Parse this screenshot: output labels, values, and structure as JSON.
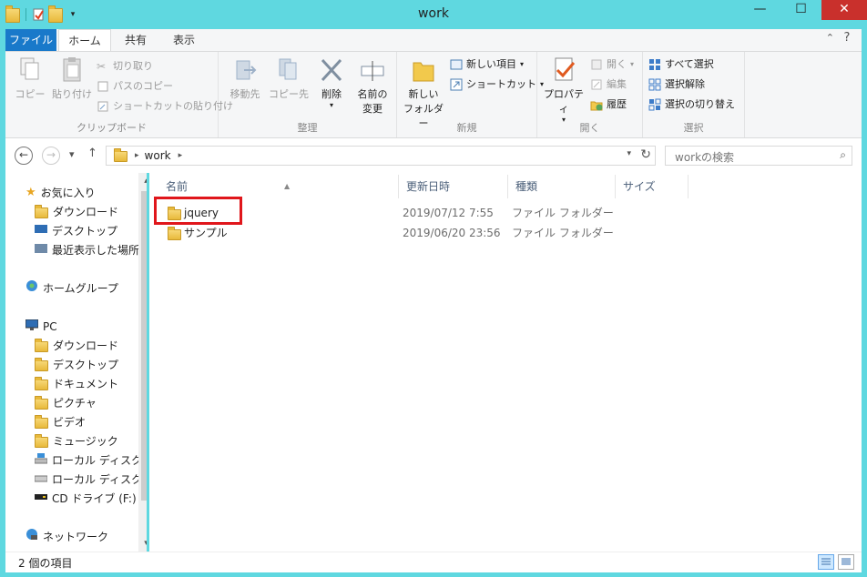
{
  "window": {
    "title": "work",
    "minimize_glyph": "—",
    "maximize_glyph": "☐",
    "close_glyph": "✕"
  },
  "ribbon_tabs": [
    {
      "label": "ファイル"
    },
    {
      "label": "ホーム"
    },
    {
      "label": "共有"
    },
    {
      "label": "表示"
    }
  ],
  "ribbon": {
    "clipboard": {
      "label": "クリップボード",
      "copy": "コピー",
      "paste": "貼り付け",
      "cut": "切り取り",
      "copy_path": "パスのコピー",
      "paste_shortcut": "ショートカットの貼り付け"
    },
    "organize": {
      "label": "整理",
      "move_to": "移動先",
      "copy_to": "コピー先",
      "delete": "削除",
      "rename_line1": "名前の",
      "rename_line2": "変更"
    },
    "new": {
      "label": "新規",
      "new_folder_line1": "新しい",
      "new_folder_line2": "フォルダー",
      "new_item": "新しい項目",
      "shortcut": "ショートカット"
    },
    "open": {
      "label": "開く",
      "properties": "プロパティ",
      "open": "開く",
      "edit": "編集",
      "history": "履歴"
    },
    "select": {
      "label": "選択",
      "select_all": "すべて選択",
      "select_none": "選択解除",
      "invert": "選択の切り替え"
    }
  },
  "address": {
    "crumb": "work",
    "search_placeholder": "workの検索"
  },
  "nav_pane": {
    "favorites": "お気に入り",
    "fav_items": [
      "ダウンロード",
      "デスクトップ",
      "最近表示した場所"
    ],
    "homegroup": "ホームグループ",
    "pc": "PC",
    "pc_items": [
      "ダウンロード",
      "デスクトップ",
      "ドキュメント",
      "ピクチャ",
      "ビデオ",
      "ミュージック",
      "ローカル ディスク (",
      "ローカル ディスク (",
      "CD ドライブ (F:)"
    ],
    "network": "ネットワーク"
  },
  "columns": {
    "name": "名前",
    "date": "更新日時",
    "type": "種類",
    "size": "サイズ"
  },
  "files": [
    {
      "name": "jquery",
      "date": "2019/07/12 7:55",
      "type": "ファイル フォルダー",
      "size": ""
    },
    {
      "name": "サンプル",
      "date": "2019/06/20 23:56",
      "type": "ファイル フォルダー",
      "size": ""
    }
  ],
  "status": {
    "item_count": "2 個の項目"
  },
  "colors": {
    "titlebar": "#5fd8e0",
    "file_tab": "#1979ca",
    "close_button": "#c9302c",
    "highlight": "#e0161b"
  }
}
